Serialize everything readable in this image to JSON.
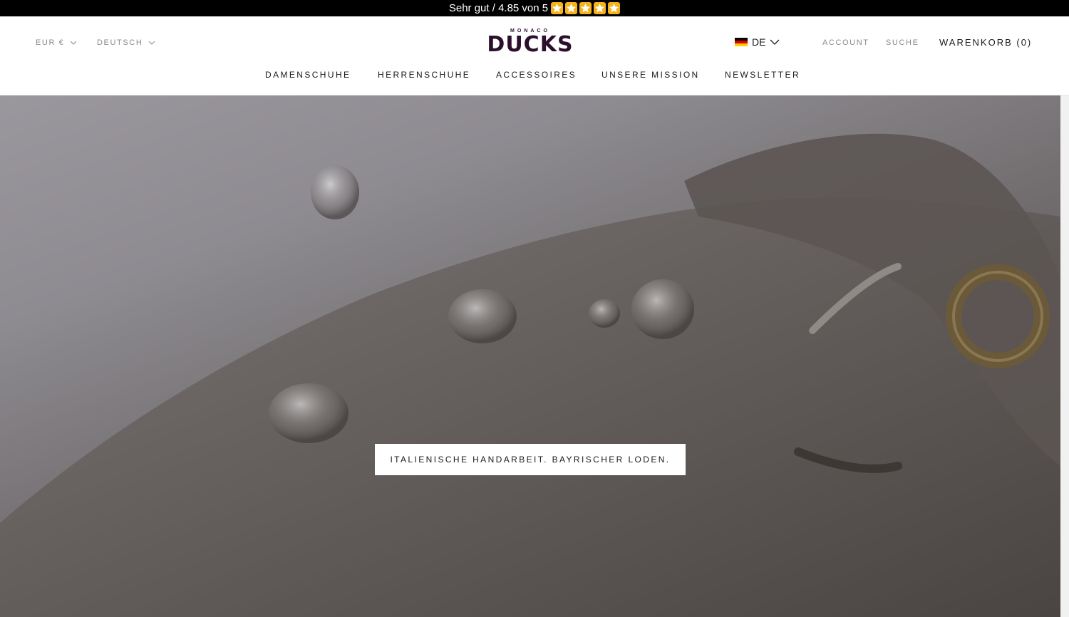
{
  "announcement": {
    "rating_text": "Sehr gut / 4.85 von 5",
    "stars": 5,
    "star_color": "#f5b21b"
  },
  "header": {
    "currency": "EUR €",
    "language": "DEUTSCH",
    "logo_small": "MONACO",
    "logo_big": "DUCKS",
    "logo_color": "#2b0f2b",
    "lang_switch": "DE",
    "account": "ACCOUNT",
    "search": "SUCHE",
    "cart": "WARENKORB (0)"
  },
  "nav": {
    "items": [
      {
        "label": "DAMENSCHUHE"
      },
      {
        "label": "HERRENSCHUHE"
      },
      {
        "label": "ACCESSOIRES"
      },
      {
        "label": "UNSERE MISSION"
      },
      {
        "label": "NEWSLETTER"
      }
    ]
  },
  "hero": {
    "cta": "ITALIENISCHE HANDARBEIT. BAYRISCHER LODEN."
  }
}
